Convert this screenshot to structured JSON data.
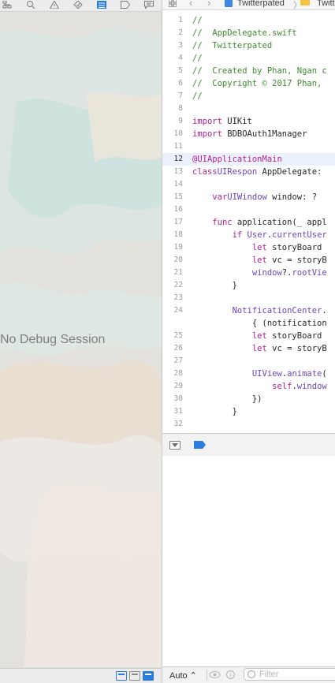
{
  "navigator": {
    "toolbar_icons": [
      "hierarchy-icon",
      "search-icon",
      "warning-icon",
      "test-diamond-icon",
      "debug-navigator-icon",
      "breakpoint-icon",
      "report-icon"
    ],
    "empty_message": "No Debug Session",
    "bottom_icons": [
      "view-options-icon",
      "thread-view-icon",
      "queue-view-icon"
    ]
  },
  "jump_bar": {
    "project": "Twitterpated",
    "folder": "Twitt"
  },
  "code_lines": [
    {
      "n": "1",
      "text": "//",
      "kind": "comment"
    },
    {
      "n": "2",
      "text": "//  AppDelegate.swift",
      "kind": "comment"
    },
    {
      "n": "3",
      "text": "//  Twitterpated",
      "kind": "comment"
    },
    {
      "n": "4",
      "text": "//",
      "kind": "comment"
    },
    {
      "n": "5",
      "text": "//  Created by Phan, Ngan c",
      "kind": "comment"
    },
    {
      "n": "6",
      "text": "//  Copyright © 2017 Phan,",
      "kind": "comment"
    },
    {
      "n": "7",
      "text": "//",
      "kind": "comment"
    },
    {
      "n": "8",
      "text": ""
    },
    {
      "n": "9",
      "kw": "import",
      "rest": " UIKit"
    },
    {
      "n": "10",
      "kw": "import",
      "rest": " BDBOAuth1Manager"
    },
    {
      "n": "11",
      "text": ""
    },
    {
      "n": "12",
      "attr": "@UIApplicationMain",
      "current": true
    },
    {
      "n": "13",
      "kw": "class",
      "rest": " AppDelegate: ",
      "type": "UIRespon"
    },
    {
      "n": "14",
      "text": ""
    },
    {
      "n": "15",
      "indent": "    ",
      "kw": "var",
      "rest": " window: ",
      "type": "UIWindow",
      "rest2": "?"
    },
    {
      "n": "16",
      "text": ""
    },
    {
      "n": "17",
      "indent": "    ",
      "kw": "func",
      "rest": " application(_ appl"
    },
    {
      "n": "18",
      "indent": "        ",
      "kw": "if",
      "type": " User",
      "rest": ".",
      "type2": "currentUser"
    },
    {
      "n": "19",
      "indent": "            ",
      "kw": "let",
      "rest": " storyBoard"
    },
    {
      "n": "20",
      "indent": "            ",
      "kw": "let",
      "rest": " vc = storyB"
    },
    {
      "n": "21",
      "indent": "            ",
      "type": "window",
      "rest": "?.",
      "type2": "rootVie"
    },
    {
      "n": "22",
      "text": "        }"
    },
    {
      "n": "23",
      "text": ""
    },
    {
      "n": "24",
      "indent": "        ",
      "type": "NotificationCenter",
      "rest": "."
    },
    {
      "n": "",
      "text": "            { (notification"
    },
    {
      "n": "25",
      "indent": "            ",
      "kw": "let",
      "rest": " storyBoard"
    },
    {
      "n": "26",
      "indent": "            ",
      "kw": "let",
      "rest": " vc = storyB"
    },
    {
      "n": "27",
      "text": ""
    },
    {
      "n": "28",
      "indent": "            ",
      "type": "UIView",
      "rest": ".",
      "type2": "animate",
      "rest2": "("
    },
    {
      "n": "29",
      "indent": "                ",
      "kw": "self",
      "rest": ".",
      "type2": "window"
    },
    {
      "n": "30",
      "text": "            })"
    },
    {
      "n": "31",
      "text": "        }"
    },
    {
      "n": "32",
      "text": ""
    }
  ],
  "debug_area": {
    "scope_value": "Auto ⌃",
    "filter_placeholder": "Filter"
  },
  "colors": {
    "accent": "#2a7de1",
    "comment": "#3d8a2e",
    "keyword": "#b0209d",
    "type": "#6f42c1"
  }
}
